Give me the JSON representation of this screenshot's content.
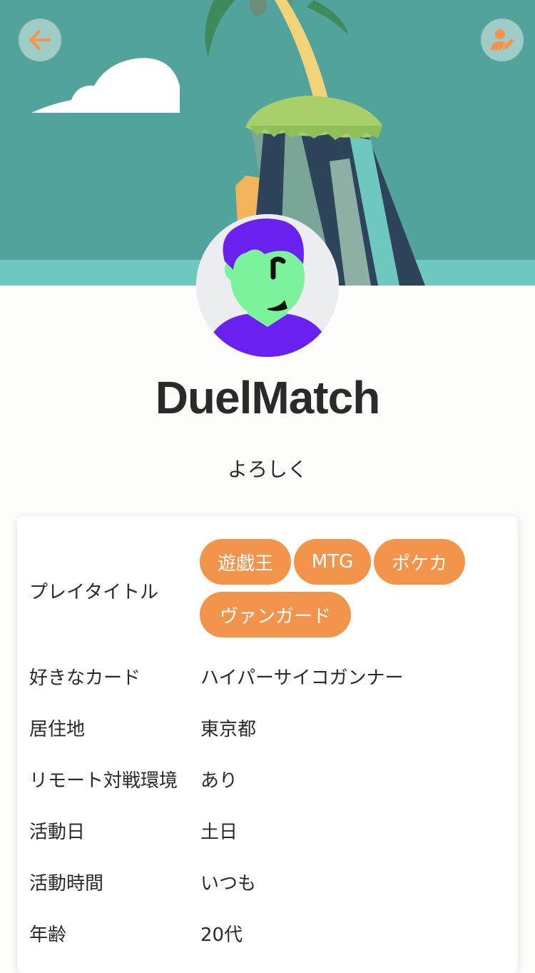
{
  "header": {
    "back_icon": "arrow-left-icon",
    "edit_icon": "user-edit-icon",
    "accent_color": "#f2944c",
    "sky_color": "#52a39c"
  },
  "profile": {
    "username": "DuelMatch",
    "bio": "よろしく"
  },
  "details": {
    "play_titles_label": "プレイタイトル",
    "play_titles": [
      "遊戯王",
      "MTG",
      "ポケカ",
      "ヴァンガード"
    ],
    "rows": [
      {
        "label": "好きなカード",
        "value": "ハイパーサイコガンナー"
      },
      {
        "label": "居住地",
        "value": "東京都"
      },
      {
        "label": "リモート対戦環境",
        "value": "あり"
      },
      {
        "label": "活動日",
        "value": "土日"
      },
      {
        "label": "活動時間",
        "value": "いつも"
      },
      {
        "label": "年齢",
        "value": "20代"
      }
    ]
  }
}
